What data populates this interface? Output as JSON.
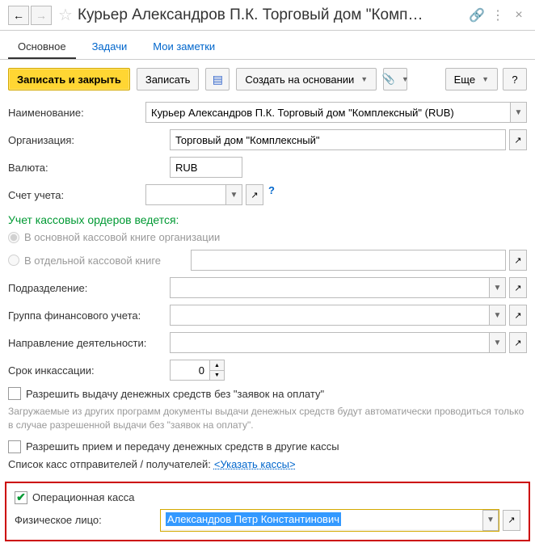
{
  "header": {
    "title": "Курьер Александров П.К. Торговый дом \"Комп…"
  },
  "tabs": {
    "main": "Основное",
    "tasks": "Задачи",
    "notes": "Мои заметки"
  },
  "toolbar": {
    "save_close": "Записать и закрыть",
    "save": "Записать",
    "create_based": "Создать на основании",
    "more": "Еще",
    "help": "?"
  },
  "fields": {
    "name_label": "Наименование:",
    "name_value": "Курьер Александров П.К. Торговый дом \"Комплексный\" (RUB)",
    "org_label": "Организация:",
    "org_value": "Торговый дом \"Комплексный\"",
    "currency_label": "Валюта:",
    "currency_value": "RUB",
    "account_label": "Счет учета:",
    "section": "Учет кассовых ордеров ведется:",
    "radio1": "В основной кассовой книге организации",
    "radio2": "В отдельной кассовой книге",
    "dept_label": "Подразделение:",
    "fin_group_label": "Группа финансового учета:",
    "activity_label": "Направление деятельности:",
    "collection_label": "Срок инкассации:",
    "collection_value": "0",
    "allow_issue": "Разрешить выдачу денежных средств без \"заявок на оплату\"",
    "note1": "Загружаемые из других программ документы выдачи денежных средств будут автоматически проводиться только в случае разрешенной выдачи без \"заявок на оплату\".",
    "allow_transfer": "Разрешить прием и передачу денежных средств в другие кассы",
    "list_label": "Список касс отправителей / получателей:",
    "list_link": "<Указать кассы>",
    "op_cash": "Операционная касса",
    "person_label": "Физическое лицо:",
    "person_value": "Александров Петр Константинович"
  }
}
